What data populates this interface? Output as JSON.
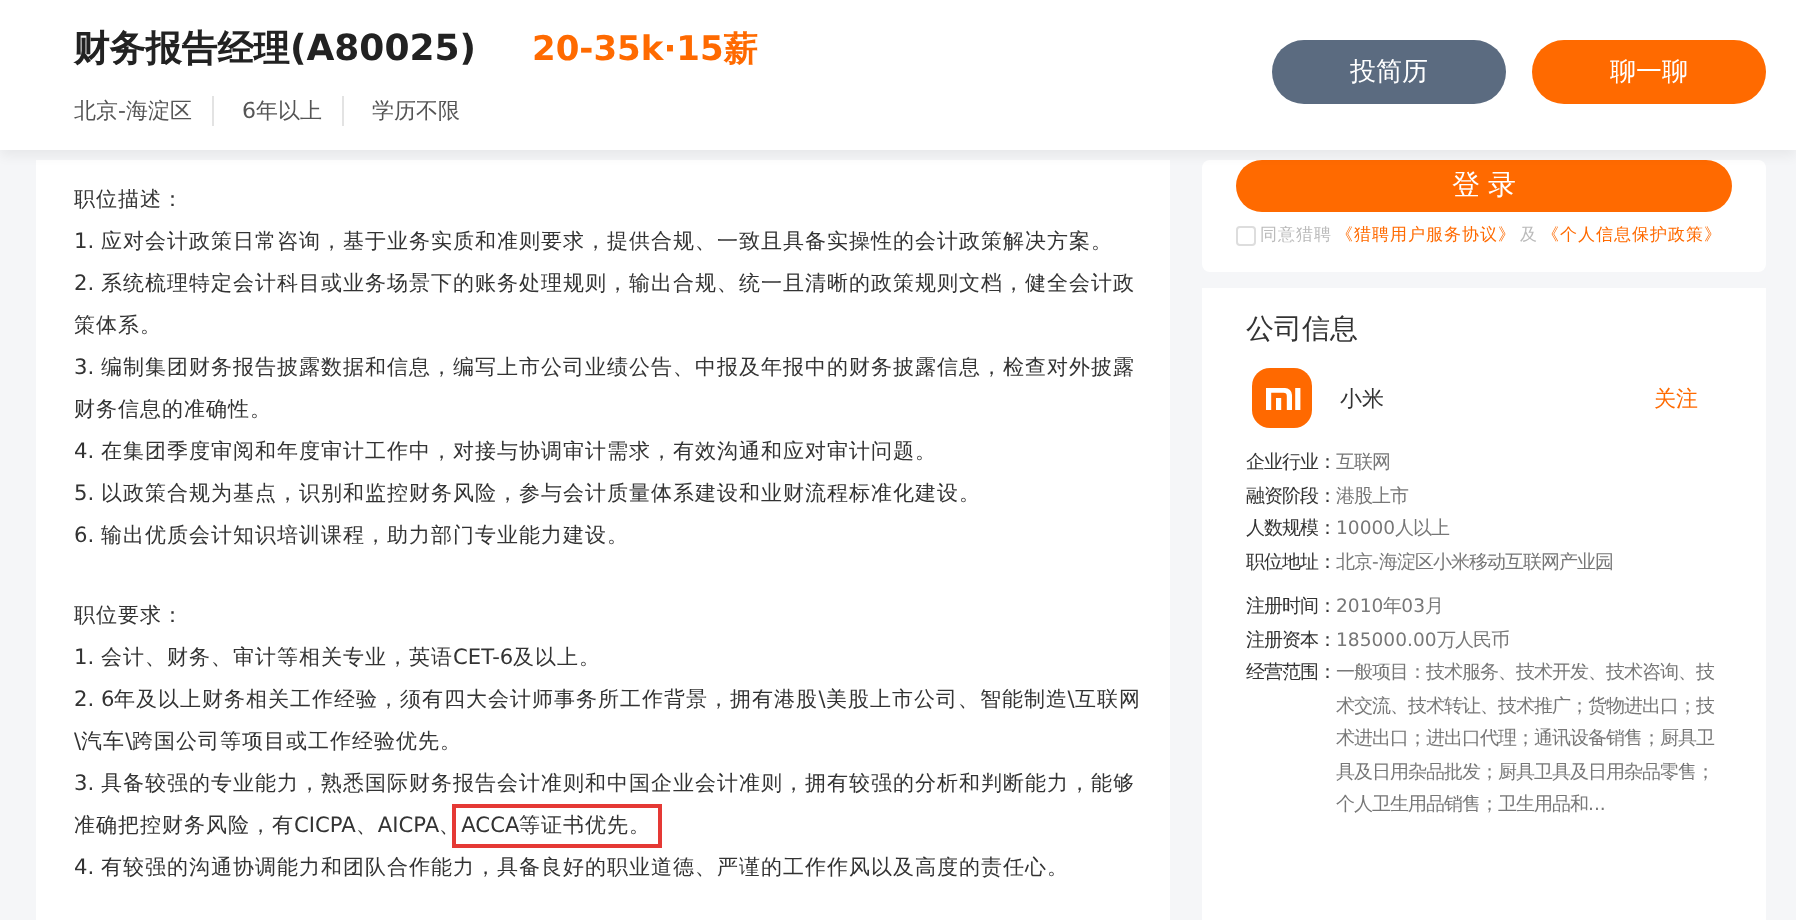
{
  "header": {
    "title": "财务报告经理(A80025)",
    "salary": "20-35k·15薪",
    "meta": [
      "北京-海淀区",
      "6年以上",
      "学历不限"
    ],
    "buttons": [
      {
        "label": "投简历",
        "kind": "secondary"
      },
      {
        "label": "聊一聊",
        "kind": "primary"
      }
    ]
  },
  "login": {
    "button": "登 录",
    "agreement": {
      "checked": false,
      "prefix": "同意猎聘",
      "links": [
        "《猎聘用户服务协议》",
        "《个人信息保护政策》"
      ],
      "joiner": "及"
    }
  },
  "description": {
    "heading": "职位描述：",
    "items": [
      "1. 应对会计政策日常咨询，基于业务实质和准则要求，提供合规、一致且具备实操性的会计政策解决方案。",
      "2. 系统梳理特定会计科目或业务场景下的账务处理规则，输出合规、统一且清晰的政策规则文档，健全会计政策体系。",
      "3. 编制集团财务报告披露数据和信息，编写上市公司业绩公告、中报及年报中的财务披露信息，检查对外披露财务信息的准确性。",
      "4. 在集团季度审阅和年度审计工作中，对接与协调审计需求，有效沟通和应对审计问题。",
      "5. 以政策合规为基点，识别和监控财务风险，参与会计质量体系建设和业财流程标准化建设。",
      "6. 输出优质会计知识培训课程，助力部门专业能力建设。"
    ]
  },
  "requirements": {
    "heading": "职位要求：",
    "items": [
      {
        "text": "1. 会计、财务、审计等相关专业，英语CET-6及以上。"
      },
      {
        "text": "2. 6年及以上财务相关工作经验，须有四大会计师事务所工作背景，拥有港股\\美股上市公司、智能制造\\互联网\\汽车\\跨国公司等项目或工作经验优先。"
      },
      {
        "text": "3. 具备较强的专业能力，熟悉国际财务报告会计准则和中国企业会计准则，拥有较强的分析和判断能力，能够准确把控财务风险，有CICPA、AICPA、",
        "highlight": "ACCA等证书优先。"
      },
      {
        "text": "4. 有较强的沟通协调能力和团队合作能力，具备良好的职业道德、严谨的工作作风以及高度的责任心。"
      }
    ]
  },
  "company": {
    "title": "公司信息",
    "name": "小米",
    "follow": "关注",
    "info_groups": [
      [
        {
          "label": "企业行业：",
          "value": "互联网"
        },
        {
          "label": "融资阶段：",
          "value": "港股上市"
        },
        {
          "label": "人数规模：",
          "value": "10000人以上"
        },
        {
          "label": "职位地址：",
          "value": "北京-海淀区小米移动互联网产业园"
        }
      ],
      [
        {
          "label": "注册时间：",
          "value": "2010年03月"
        },
        {
          "label": "注册资本：",
          "value": "185000.00万人民币"
        },
        {
          "label": "经营范围：",
          "value": "一般项目：技术服务、技术开发、技术咨询、技术交流、技术转让、技术推广；货物进出口；技术进出口；进出口代理；通讯设备销售；厨具卫具及日用杂品批发；厨具卫具及日用杂品零售；个人卫生用品销售；卫生用品和..."
        }
      ]
    ]
  }
}
